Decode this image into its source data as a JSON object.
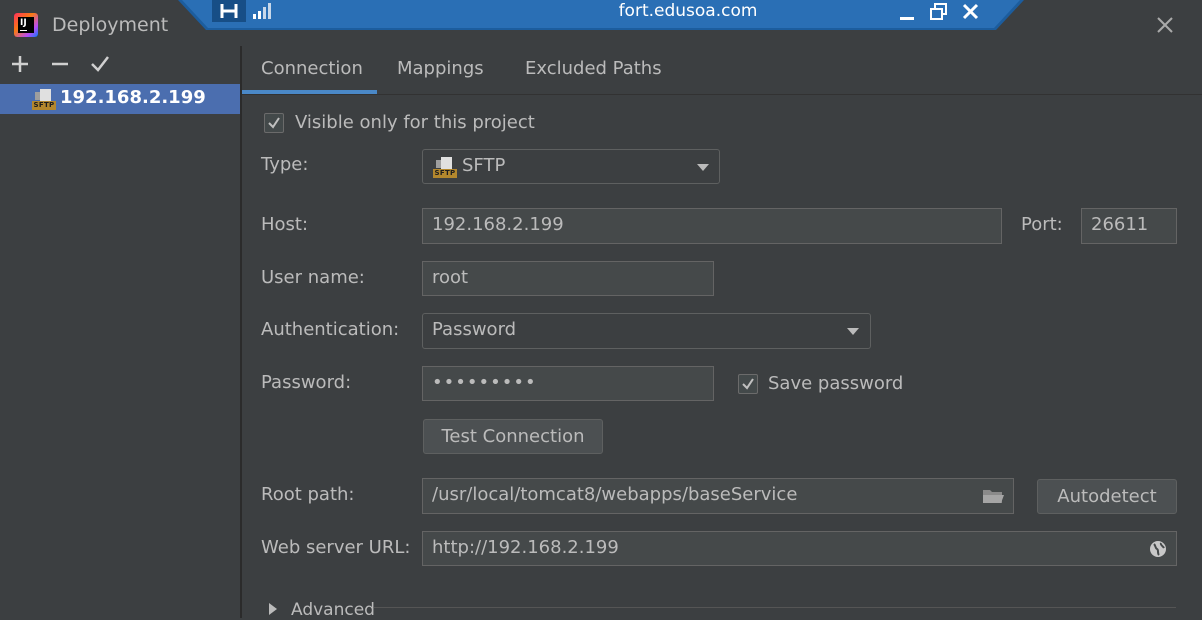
{
  "window": {
    "title": "Deployment"
  },
  "remote": {
    "title": "fort.edusoa.com"
  },
  "left_panel": {
    "server": {
      "label": "192.168.2.199",
      "icon": "sftp-icon"
    }
  },
  "sftp_badge": "SFTP",
  "tabs": [
    {
      "label": "Connection",
      "active": true
    },
    {
      "label": "Mappings",
      "active": false
    },
    {
      "label": "Excluded Paths",
      "active": false
    }
  ],
  "form": {
    "visible_only": {
      "label": "Visible only for this project",
      "checked": true
    },
    "type": {
      "label": "Type:",
      "value": "SFTP"
    },
    "host": {
      "label": "Host:",
      "value": "192.168.2.199"
    },
    "port": {
      "label": "Port:",
      "value": "26611"
    },
    "username": {
      "label": "User name:",
      "value": "root"
    },
    "auth": {
      "label": "Authentication:",
      "value": "Password"
    },
    "password": {
      "label": "Password:",
      "value": "•••••••••"
    },
    "save_password": {
      "label": "Save password",
      "checked": true
    },
    "test_connection": {
      "label": "Test Connection"
    },
    "root_path": {
      "label": "Root path:",
      "value": "/usr/local/tomcat8/webapps/baseService"
    },
    "autodetect": {
      "label": "Autodetect"
    },
    "web_url": {
      "label": "Web server URL:",
      "value": "http://192.168.2.199"
    },
    "advanced": {
      "label": "Advanced"
    }
  },
  "colors": {
    "accent": "#4a88c7",
    "selection": "#4b6eaf",
    "background": "#3c3f41",
    "remote_bar": "#1c5d9e"
  }
}
